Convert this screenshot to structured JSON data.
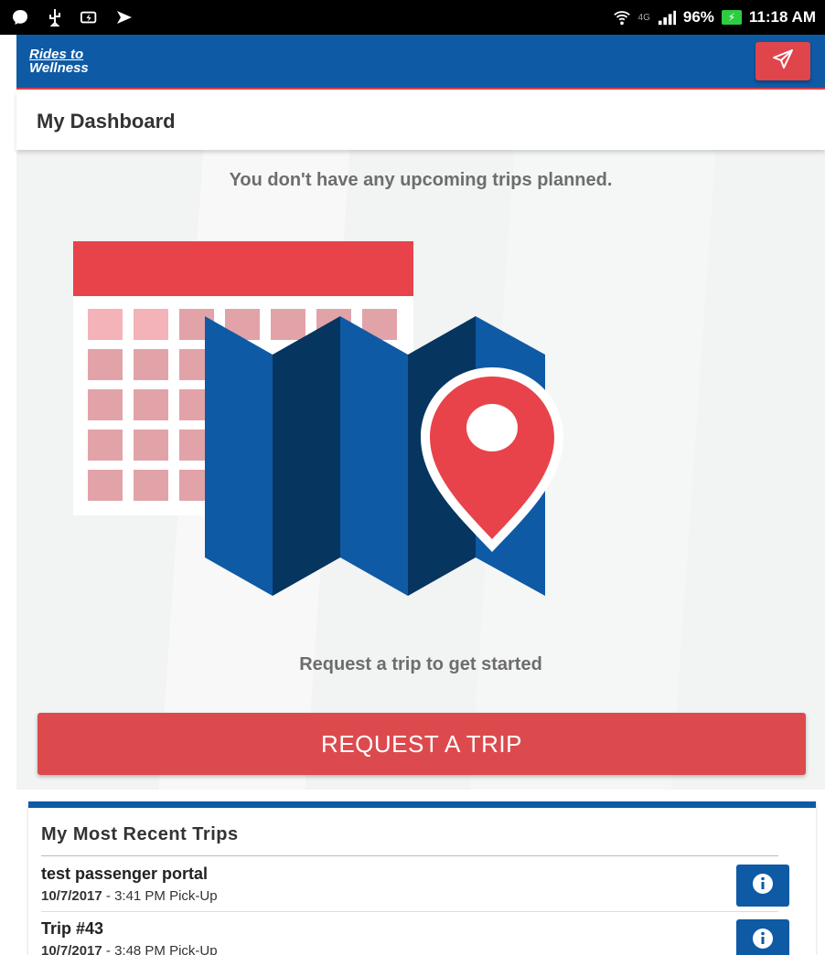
{
  "status_bar": {
    "battery": "96%",
    "time": "11:18 AM",
    "network": "4G",
    "icons": [
      "messenger-icon",
      "usb-icon",
      "charging-icon",
      "cast-icon",
      "wifi-icon",
      "signal-icon",
      "battery-icon"
    ]
  },
  "header": {
    "logo_line1": "Rides to",
    "logo_line2": "Wellness",
    "send_icon": "paper-plane-icon",
    "colors": {
      "bar": "#0e5aa5",
      "accent": "#e0454c"
    }
  },
  "page": {
    "title": "My Dashboard"
  },
  "dashboard": {
    "no_trips_message": "You don't have any upcoming trips planned.",
    "illustration": "calendar-map-pin-illustration",
    "get_started_message": "Request a trip to get started",
    "request_button_label": "REQUEST A TRIP"
  },
  "recent_trips": {
    "heading": "My Most Recent Trips",
    "items": [
      {
        "name": "test passenger portal",
        "date": "10/7/2017",
        "detail": " - 3:41 PM Pick-Up",
        "icon": "info-icon"
      },
      {
        "name": "Trip #43",
        "date": "10/7/2017",
        "detail": " - 3:48 PM Pick-Up",
        "icon": "info-icon"
      }
    ]
  }
}
